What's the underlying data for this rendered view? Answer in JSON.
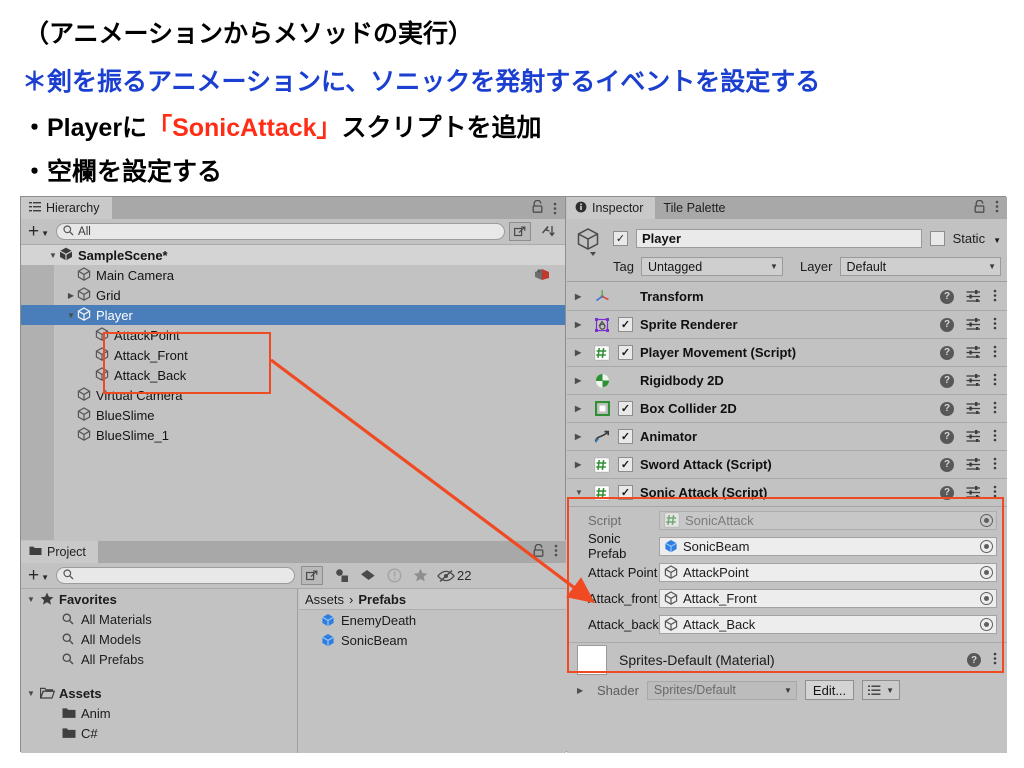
{
  "slide": {
    "line1": "（アニメーションからメソッドの実行）",
    "line2": "＊剣を振るアニメーションに、ソニックを発射するイベントを設定する",
    "line3_pre": "・Playerに",
    "line3_hl": "「SonicAttack」",
    "line3_post": "スクリプトを追加",
    "line4": "・空欄を設定する",
    "colors": {
      "heading_blue": "#1b3fd1",
      "highlight_red": "#ff2d16",
      "annotation_red": "#f04a23"
    }
  },
  "hierarchy": {
    "tab_label": "Hierarchy",
    "tab_icon": "hierarchy-icon",
    "add_label": "+",
    "search_placeholder": "All",
    "rows": [
      {
        "label": "SampleScene*",
        "depth": 1,
        "twisty": "down",
        "icon": "unity-scene-icon",
        "selected": false,
        "scene": true,
        "badge": ""
      },
      {
        "label": "Main Camera",
        "depth": 2,
        "twisty": "none",
        "icon": "gameobject-icon",
        "selected": false,
        "scene": false,
        "badge": "camera-brain-icon"
      },
      {
        "label": "Grid",
        "depth": 2,
        "twisty": "right",
        "icon": "gameobject-icon",
        "selected": false,
        "scene": false,
        "badge": ""
      },
      {
        "label": "Player",
        "depth": 2,
        "twisty": "down",
        "icon": "gameobject-icon",
        "selected": true,
        "scene": false,
        "badge": ""
      },
      {
        "label": "AttackPoint",
        "depth": 3,
        "twisty": "none",
        "icon": "gameobject-icon",
        "selected": false,
        "scene": false,
        "badge": ""
      },
      {
        "label": "Attack_Front",
        "depth": 3,
        "twisty": "none",
        "icon": "gameobject-icon",
        "selected": false,
        "scene": false,
        "badge": ""
      },
      {
        "label": "Attack_Back",
        "depth": 3,
        "twisty": "none",
        "icon": "gameobject-icon",
        "selected": false,
        "scene": false,
        "badge": ""
      },
      {
        "label": "Virtual Camera",
        "depth": 2,
        "twisty": "none",
        "icon": "gameobject-icon",
        "selected": false,
        "scene": false,
        "badge": ""
      },
      {
        "label": "BlueSlime",
        "depth": 2,
        "twisty": "none",
        "icon": "gameobject-icon",
        "selected": false,
        "scene": false,
        "badge": ""
      },
      {
        "label": "BlueSlime_1",
        "depth": 2,
        "twisty": "none",
        "icon": "gameobject-icon",
        "selected": false,
        "scene": false,
        "badge": ""
      }
    ]
  },
  "project": {
    "tab_label": "Project",
    "tab_icon": "folder-icon",
    "add_label": "+",
    "search_placeholder": "",
    "hidden_count": "22",
    "tree": [
      {
        "label": "Favorites",
        "depth": 0,
        "twisty": "down",
        "icon": "star-icon",
        "bold": true
      },
      {
        "label": "All Materials",
        "depth": 1,
        "twisty": "none",
        "icon": "search-icon",
        "bold": false
      },
      {
        "label": "All Models",
        "depth": 1,
        "twisty": "none",
        "icon": "search-icon",
        "bold": false
      },
      {
        "label": "All Prefabs",
        "depth": 1,
        "twisty": "none",
        "icon": "search-icon",
        "bold": false
      },
      {
        "label": "",
        "depth": 0,
        "twisty": "none",
        "icon": "",
        "bold": false
      },
      {
        "label": "Assets",
        "depth": 0,
        "twisty": "down",
        "icon": "folder-open-icon",
        "bold": true
      },
      {
        "label": "Anim",
        "depth": 1,
        "twisty": "none",
        "icon": "folder-icon",
        "bold": false
      },
      {
        "label": "C#",
        "depth": 1,
        "twisty": "none",
        "icon": "folder-icon",
        "bold": false
      }
    ],
    "breadcrumb": {
      "root": "Assets",
      "sep": "›",
      "current": "Prefabs"
    },
    "assets": [
      {
        "label": "EnemyDeath",
        "icon": "prefab-icon"
      },
      {
        "label": "SonicBeam",
        "icon": "prefab-icon"
      }
    ]
  },
  "inspector": {
    "tabs": [
      {
        "label": "Inspector",
        "icon": "info-icon",
        "active": true
      },
      {
        "label": "Tile Palette",
        "icon": "",
        "active": false
      }
    ],
    "object": {
      "enabled_check": "✓",
      "name": "Player",
      "static_label": "Static",
      "tag_label": "Tag",
      "tag_value": "Untagged",
      "layer_label": "Layer",
      "layer_value": "Default"
    },
    "components": [
      {
        "name": "Transform",
        "icon": "transform-icon",
        "twisty": "right",
        "has_toggle": false,
        "checked": false,
        "highlight": false
      },
      {
        "name": "Sprite Renderer",
        "icon": "sprite-renderer-icon",
        "twisty": "right",
        "has_toggle": true,
        "checked": true,
        "highlight": false
      },
      {
        "name": "Player Movement (Script)",
        "icon": "csharp-script-icon",
        "twisty": "right",
        "has_toggle": true,
        "checked": true,
        "highlight": false
      },
      {
        "name": "Rigidbody 2D",
        "icon": "rigidbody2d-icon",
        "twisty": "right",
        "has_toggle": false,
        "checked": false,
        "highlight": false
      },
      {
        "name": "Box Collider 2D",
        "icon": "boxcollider2d-icon",
        "twisty": "right",
        "has_toggle": true,
        "checked": true,
        "highlight": false
      },
      {
        "name": "Animator",
        "icon": "animator-icon",
        "twisty": "right",
        "has_toggle": true,
        "checked": true,
        "highlight": false
      },
      {
        "name": "Sword Attack (Script)",
        "icon": "csharp-script-icon",
        "twisty": "right",
        "has_toggle": true,
        "checked": true,
        "highlight": false
      },
      {
        "name": "Sonic Attack (Script)",
        "icon": "csharp-script-icon",
        "twisty": "down",
        "has_toggle": true,
        "checked": true,
        "highlight": true
      }
    ],
    "sonic_attack_props": [
      {
        "label": "Script",
        "value": "SonicAttack",
        "icon": "csharp-script-icon",
        "disabled": true
      },
      {
        "label": "Sonic Prefab",
        "value": "SonicBeam",
        "icon": "prefab-icon",
        "disabled": false
      },
      {
        "label": "Attack Point",
        "value": "AttackPoint",
        "icon": "gameobject-icon",
        "disabled": false
      },
      {
        "label": "Attack_front",
        "value": "Attack_Front",
        "icon": "gameobject-icon",
        "disabled": false
      },
      {
        "label": "Attack_back",
        "value": "Attack_Back",
        "icon": "gameobject-icon",
        "disabled": false
      }
    ],
    "material": {
      "title": "Sprites-Default (Material)",
      "shader_label": "Shader",
      "shader_value": "Sprites/Default",
      "edit_label": "Edit..."
    }
  }
}
